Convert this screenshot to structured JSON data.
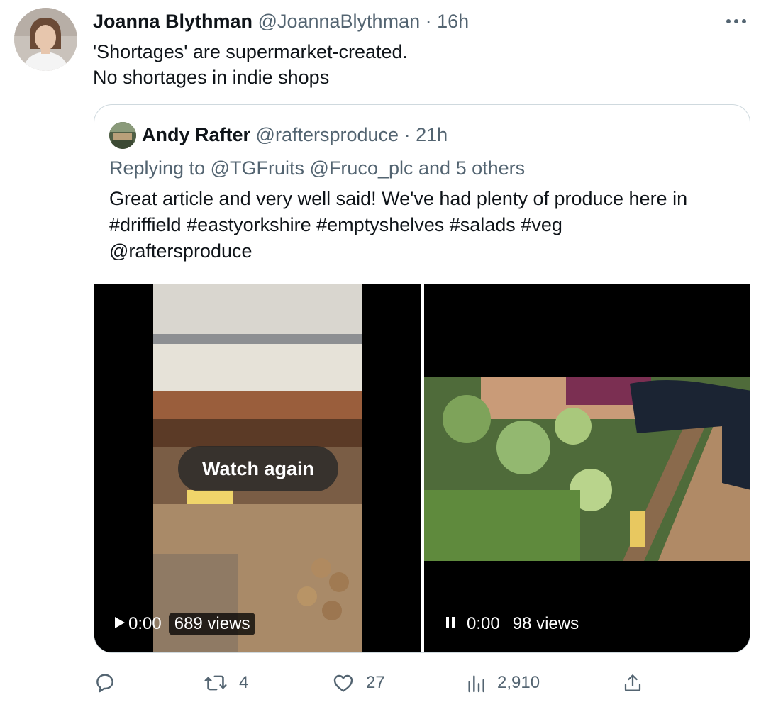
{
  "tweet": {
    "author_name": "Joanna Blythman",
    "author_handle": "@JoannaBlythman",
    "separator": "·",
    "time": "16h",
    "text_line1": "'Shortages' are supermarket-created.",
    "text_line2": "No shortages in indie shops"
  },
  "quoted": {
    "author_name": "Andy Rafter",
    "author_handle": "@raftersproduce",
    "separator": "·",
    "time": "21h",
    "replying_prefix": "Replying to",
    "mention1": "@TGFruits",
    "mention2": "@Fruco_plc",
    "replying_suffix": "and 5 others",
    "text_line1": "Great article and very well said! We've had plenty of produce here in",
    "text_line2": "#driffield #eastyorkshire  #emptyshelves #salads #veg",
    "text_line3": "@raftersproduce"
  },
  "videos": [
    {
      "overlay_label": "Watch again",
      "time": "0:00",
      "views": "689 views",
      "state": "play"
    },
    {
      "time": "0:00",
      "views": "98 views",
      "state": "pause"
    }
  ],
  "actions": {
    "reply_count": "",
    "retweet_count": "4",
    "like_count": "27",
    "views_count": "2,910"
  },
  "colors": {
    "text_primary": "#0f1419",
    "text_secondary": "#536471",
    "border": "#cfd9de"
  },
  "icons": [
    "more-icon",
    "reply-icon",
    "retweet-icon",
    "like-icon",
    "views-icon",
    "share-icon",
    "play-icon",
    "pause-icon"
  ]
}
